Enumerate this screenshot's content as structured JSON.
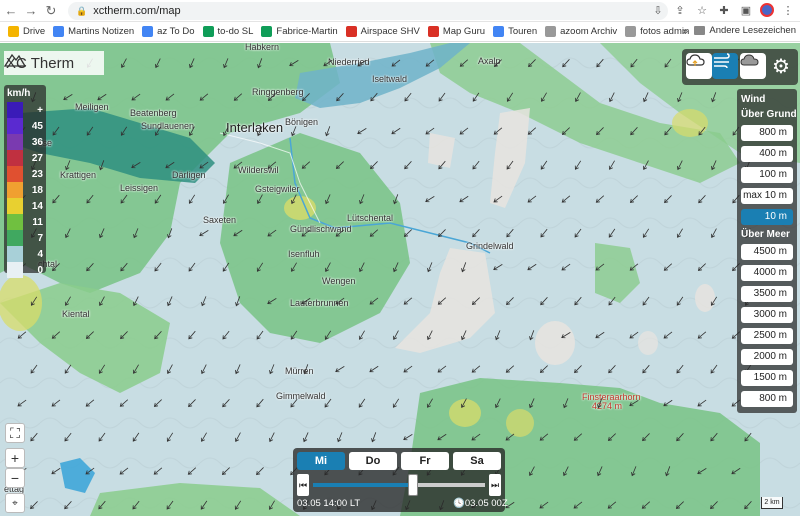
{
  "browser": {
    "url": "xctherm.com/map",
    "bookmarks": [
      {
        "label": "Drive",
        "color": "#f4b400"
      },
      {
        "label": "Martins Notizen",
        "color": "#4285f4"
      },
      {
        "label": "az To Do",
        "color": "#4285f4"
      },
      {
        "label": "to-do SL",
        "color": "#0f9d58"
      },
      {
        "label": "Fabrice-Martin",
        "color": "#0f9d58"
      },
      {
        "label": "Airspace SHV",
        "color": "#d93025"
      },
      {
        "label": "Map Guru",
        "color": "#d93025"
      },
      {
        "label": "Touren",
        "color": "#4285f4"
      },
      {
        "label": "azoom Archiv",
        "color": "#777"
      },
      {
        "label": "fotos admin",
        "color": "#777"
      }
    ],
    "more": "»",
    "other_bookmarks": "Andere Lesezeichen"
  },
  "app": {
    "title": "XC Therm"
  },
  "legend": {
    "unit": "km/h",
    "rows": [
      {
        "value": "+",
        "color": "#3a1bb8"
      },
      {
        "value": "45",
        "color": "#5a2ad0"
      },
      {
        "value": "36",
        "color": "#7a3ab0"
      },
      {
        "value": "27",
        "color": "#c03040"
      },
      {
        "value": "23",
        "color": "#e05030"
      },
      {
        "value": "18",
        "color": "#f0a030"
      },
      {
        "value": "14",
        "color": "#e8d030"
      },
      {
        "value": "11",
        "color": "#70c040"
      },
      {
        "value": "7",
        "color": "#40a860"
      },
      {
        "value": "4",
        "color": "#a8d0d8"
      },
      {
        "value": "0",
        "color": "#e8f0f4"
      }
    ]
  },
  "wind_panel": {
    "title": "Wind",
    "ground_title": "Über Grund",
    "ground_options": [
      "800 m",
      "400 m",
      "100 m",
      "max 10 m",
      "10 m"
    ],
    "selected_ground": "10 m",
    "sea_title": "Über Meer",
    "sea_options": [
      "4500 m",
      "4000 m",
      "3500 m",
      "3000 m",
      "2500 m",
      "2000 m",
      "1500 m",
      "800 m"
    ]
  },
  "places": [
    {
      "name": "Niederried"
    },
    {
      "name": "Habkern"
    },
    {
      "name": "Iseltwald"
    },
    {
      "name": "Axalp"
    },
    {
      "name": "Ringgenberg"
    },
    {
      "name": "Meiligen"
    },
    {
      "name": "Beatenberg"
    },
    {
      "name": "Sundlauenen"
    },
    {
      "name": "Interlaken"
    },
    {
      "name": "Bönigen"
    },
    {
      "name": "Krattigen"
    },
    {
      "name": "Leissigen"
    },
    {
      "name": "Därligen"
    },
    {
      "name": "Wilderswil"
    },
    {
      "name": "Gsteigwiler"
    },
    {
      "name": "Saxeten"
    },
    {
      "name": "Gündlischwand"
    },
    {
      "name": "Lütschental"
    },
    {
      "name": "Grindelwald"
    },
    {
      "name": "Isenfluh"
    },
    {
      "name": "Wengen"
    },
    {
      "name": "Lauterbrunnen"
    },
    {
      "name": "Kiental"
    },
    {
      "name": "Mürren"
    },
    {
      "name": "Gimmelwald"
    },
    {
      "name": "Finsteraarhorn"
    },
    {
      "name": "4274 m"
    },
    {
      "name": "sse"
    },
    {
      "name": "chtal"
    },
    {
      "name": "ettag"
    }
  ],
  "time": {
    "days": [
      "Mi",
      "Do",
      "Fr",
      "Sa"
    ],
    "selected_day": "Mi",
    "current_label": "03.05 14:00 LT",
    "utc_label": "03.05 00Z",
    "slider_fraction": 0.58
  },
  "scale": "2 km"
}
